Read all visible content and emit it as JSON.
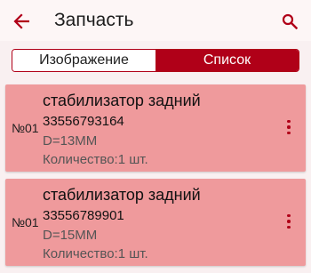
{
  "header": {
    "title": "Запчасть",
    "back_icon": "arrow-left-icon",
    "search_icon": "search-icon"
  },
  "tabs": [
    {
      "label": "Изображение",
      "selected": false
    },
    {
      "label": "Список",
      "selected": true
    }
  ],
  "items": [
    {
      "number": "№01",
      "name": "стабилизатор задний",
      "code": "33556793164",
      "size": "D=13MM",
      "quantity": "Количество:1 шт."
    },
    {
      "number": "№01",
      "name": "стабилизатор задний",
      "code": "33556789901",
      "size": "D=15MM",
      "quantity": "Количество:1 шт."
    }
  ],
  "colors": {
    "accent": "#b00018",
    "card_background": "#ef9a9c",
    "page_background": "#f9f0f1"
  }
}
